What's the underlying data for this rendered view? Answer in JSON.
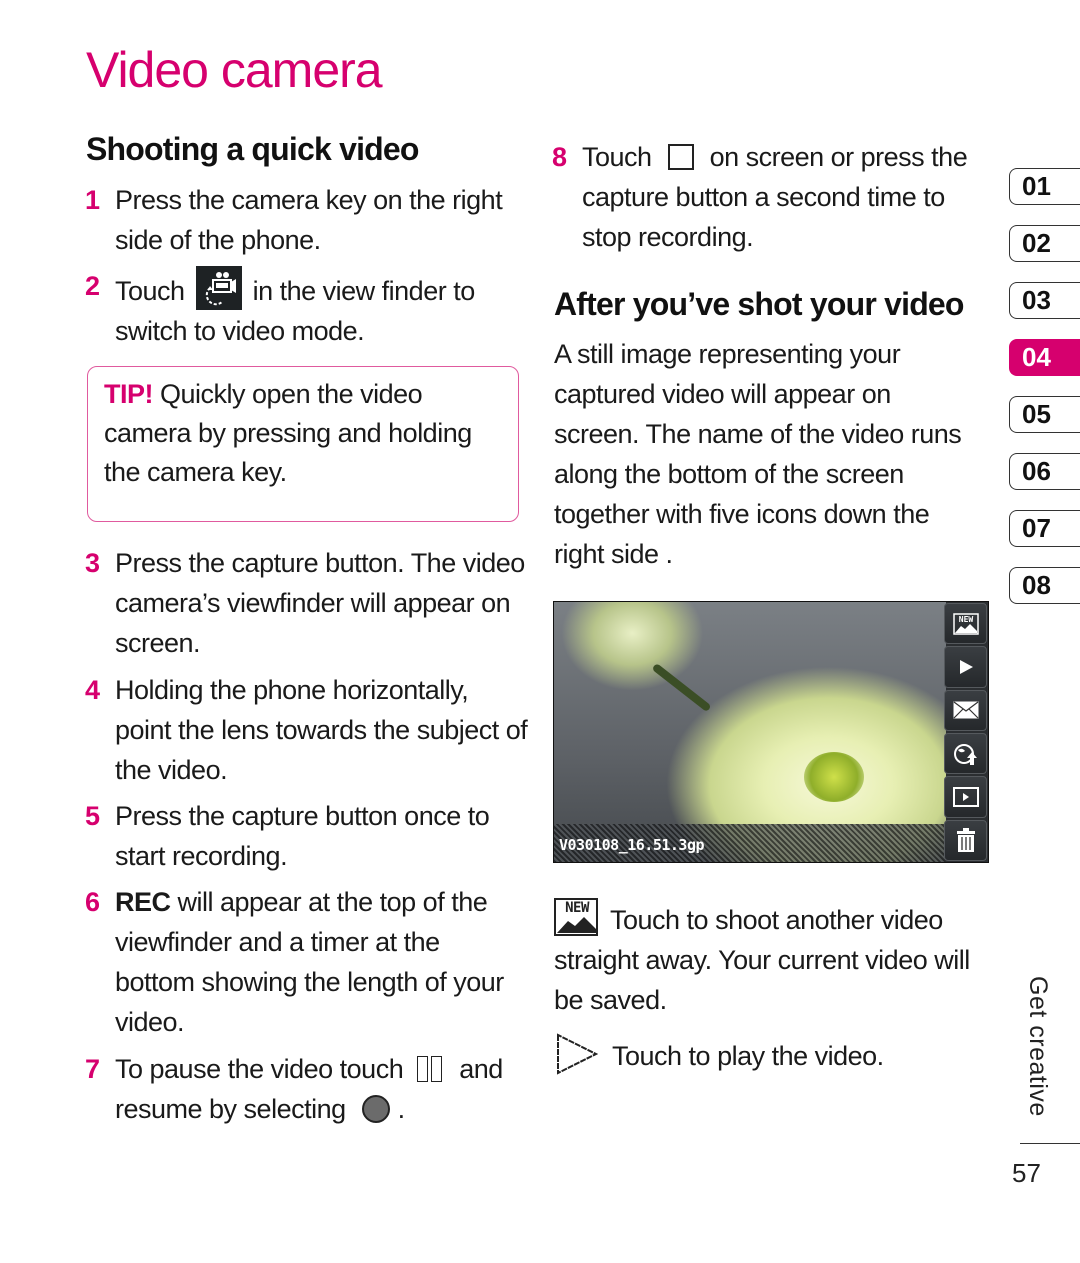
{
  "page": {
    "title": "Video camera",
    "section_label": "Get creative",
    "page_number": "57",
    "accent_color": "#d6006e"
  },
  "left": {
    "heading": "Shooting a quick video",
    "steps": [
      {
        "num": "1",
        "text": "Press the camera key on the right side of the phone."
      },
      {
        "num": "2",
        "before": "Touch",
        "after": "in the view finder to switch to video mode.",
        "icon": "camera-video-switch-icon"
      },
      {
        "num": "3",
        "text": "Press the capture button. The video camera’s viewfinder will appear on screen."
      },
      {
        "num": "4",
        "text": "Holding the phone horizontally, point the lens towards the subject of the video."
      },
      {
        "num": "5",
        "text": "Press the capture button once to start recording."
      },
      {
        "num": "6",
        "bold": "REC",
        "text": " will appear at the top of the viewfinder and a timer at the bottom showing the length of your video."
      },
      {
        "num": "7",
        "before": "To pause the video touch",
        "middle": "and resume by selecting",
        "after": ".",
        "icons": [
          "pause-icon",
          "record-icon"
        ]
      }
    ],
    "tip": {
      "label": "TIP!",
      "text": " Quickly open the video camera by pressing and holding the camera key."
    }
  },
  "right": {
    "step8": {
      "num": "8",
      "before": "Touch",
      "after": "on screen or press the capture button a second time to stop recording.",
      "icon": "stop-icon"
    },
    "heading": "After you’ve shot your video",
    "paragraph": "A still image representing your captured video will appear on screen. The name of the video runs along the bottom of the screen together with five icons down the right side .",
    "screenshot": {
      "file_name": "V030108_16.51.3gp",
      "side_icons": [
        "new-shot-icon",
        "play-icon",
        "send-message-icon",
        "upload-icon",
        "video-gallery-icon",
        "delete-icon"
      ]
    },
    "legend": [
      {
        "icon": "new-shot-icon",
        "text": "Touch to shoot another video straight away. Your current video will be saved."
      },
      {
        "icon": "play-outline-icon",
        "text": "Touch to play the video."
      }
    ]
  },
  "nav": {
    "items": [
      "01",
      "02",
      "03",
      "04",
      "05",
      "06",
      "07",
      "08"
    ],
    "active_index": 3
  }
}
